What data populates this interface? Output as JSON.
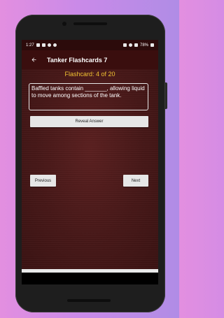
{
  "status_bar": {
    "time": "1:27",
    "battery": "78%"
  },
  "app_bar": {
    "back_icon": "arrow-left-icon",
    "title": "Tanker Flashcards 7"
  },
  "flashcard": {
    "counter": "Flashcard: 4 of 20",
    "question": "Baffled tanks contain _______, allowing liquid to move among sections of the tank."
  },
  "buttons": {
    "reveal": "Reveal Answer",
    "previous": "Previous",
    "next": "Next"
  },
  "colors": {
    "app_bar": "#3a0e0e",
    "status_bar": "#2c0b0b",
    "counter_text": "#f1c232",
    "background": "#461717"
  }
}
